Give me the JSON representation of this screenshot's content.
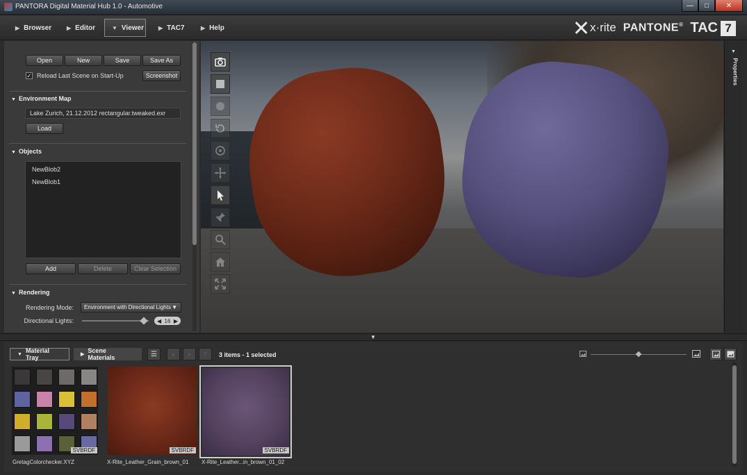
{
  "window": {
    "title": "PANTORA Digital Material Hub 1.0 - Automotive",
    "controls": [
      "minimize",
      "maximize",
      "close"
    ]
  },
  "nav": {
    "tabs": [
      {
        "label": "Browser",
        "active": false
      },
      {
        "label": "Editor",
        "active": false
      },
      {
        "label": "Viewer",
        "active": true
      },
      {
        "label": "TAC7",
        "active": false
      },
      {
        "label": "Help",
        "active": false
      }
    ],
    "brand": {
      "xrite": "x·rite",
      "pantone": "PANTONE",
      "registered": "®",
      "tac": "TAC",
      "seven": "7"
    }
  },
  "scene": {
    "open": "Open",
    "new": "New",
    "save": "Save",
    "save_as": "Save As",
    "reload_label": "Reload Last Scene on Start-Up",
    "reload_checked": true,
    "screenshot": "Screenshot"
  },
  "environment": {
    "heading": "Environment Map",
    "file": "Lake Zurich, 21.12.2012 rectangular.tweaked.exr",
    "load": "Load"
  },
  "objects": {
    "heading": "Objects",
    "items": [
      "NewBlob2",
      "NewBlob1"
    ],
    "add": "Add",
    "delete": "Delete",
    "clear": "Clear Selection"
  },
  "rendering": {
    "heading": "Rendering",
    "mode_label": "Rendering Mode:",
    "mode_value": "Environment with Directional Lights",
    "lights_label": "Directional Lights:",
    "lights_value": "16"
  },
  "properties": {
    "label": "Properties"
  },
  "viewer_tools": [
    "camera-icon",
    "stop-icon",
    "record-icon",
    "rotate-icon",
    "orbit-icon",
    "move-icon",
    "pointer-icon",
    "pin-icon",
    "zoom-icon",
    "home-icon",
    "fit-icon"
  ],
  "tray": {
    "tabs": [
      {
        "label": "Material Tray",
        "active": true
      },
      {
        "label": "Scene Materials",
        "active": false
      }
    ],
    "status": "3 items - 1 selected",
    "materials": [
      {
        "name": "GretagColorchecker.XYZ",
        "tag": "SVBRDF",
        "selected": false
      },
      {
        "name": "X-Rite_Leather_Grain_brown_01",
        "tag": "SVBRDF",
        "selected": false
      },
      {
        "name": "X-Rite_Leather...in_brown_01_02",
        "tag": "SVBRDF",
        "selected": true
      }
    ]
  },
  "colors": {
    "panel": "#3a3a3a",
    "leather_brown": "#6a2918",
    "leather_purple": "#56507e",
    "checker_swatches": [
      "#3a3838",
      "#4a4545",
      "#6e6a6a",
      "#8a8585",
      "#5e64a0",
      "#c784a8",
      "#d8c037",
      "#c0702a",
      "#cfae2c",
      "#a8b43a",
      "#584a78",
      "#b08060",
      "#9a9a9a",
      "#8c70b0",
      "#5a6038",
      "#6a68a0"
    ]
  }
}
